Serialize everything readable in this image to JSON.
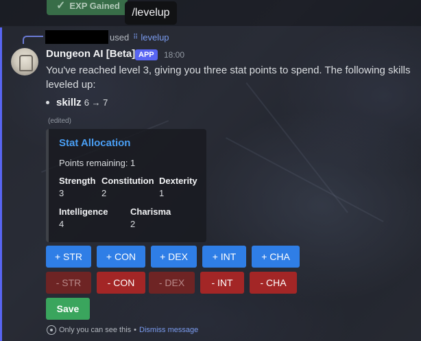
{
  "top": {
    "exp_badge": "EXP Gained",
    "tooltip": "/levelup"
  },
  "reply": {
    "used_text": "used",
    "command": "levelup"
  },
  "message": {
    "author": "Dungeon AI [Beta]",
    "app_badge": "APP",
    "timestamp": "18:00",
    "text": "You've reached level 3, giving you three stat points to spend. The following skills leveled up:",
    "skills": [
      {
        "name": "skillz",
        "change": "6 → 7"
      }
    ],
    "edited": "(edited)"
  },
  "embed": {
    "title": "Stat Allocation",
    "description": "Points remaining: 1",
    "fields": [
      {
        "name": "Strength",
        "value": "3"
      },
      {
        "name": "Constitution",
        "value": "2"
      },
      {
        "name": "Dexterity",
        "value": "1"
      },
      {
        "name": "Intelligence",
        "value": "4"
      },
      {
        "name": "Charisma",
        "value": "2"
      }
    ]
  },
  "buttons": {
    "add": [
      "+ STR",
      "+ CON",
      "+ DEX",
      "+ INT",
      "+ CHA"
    ],
    "remove": [
      "- STR",
      "- CON",
      "- DEX",
      "- INT",
      "- CHA"
    ],
    "save": "Save"
  },
  "footer": {
    "notice": "Only you can see this",
    "separator": "•",
    "dismiss": "Dismiss message"
  },
  "colors": {
    "accent": "#5865f2",
    "link": "#4a9ff5",
    "primary_button": "#2f7ee6",
    "danger_button": "#a32626",
    "success_button": "#3aa55d"
  },
  "icons": {
    "check": "check-icon",
    "command": "slash-command-icon",
    "ephemeral": "eye-icon"
  }
}
